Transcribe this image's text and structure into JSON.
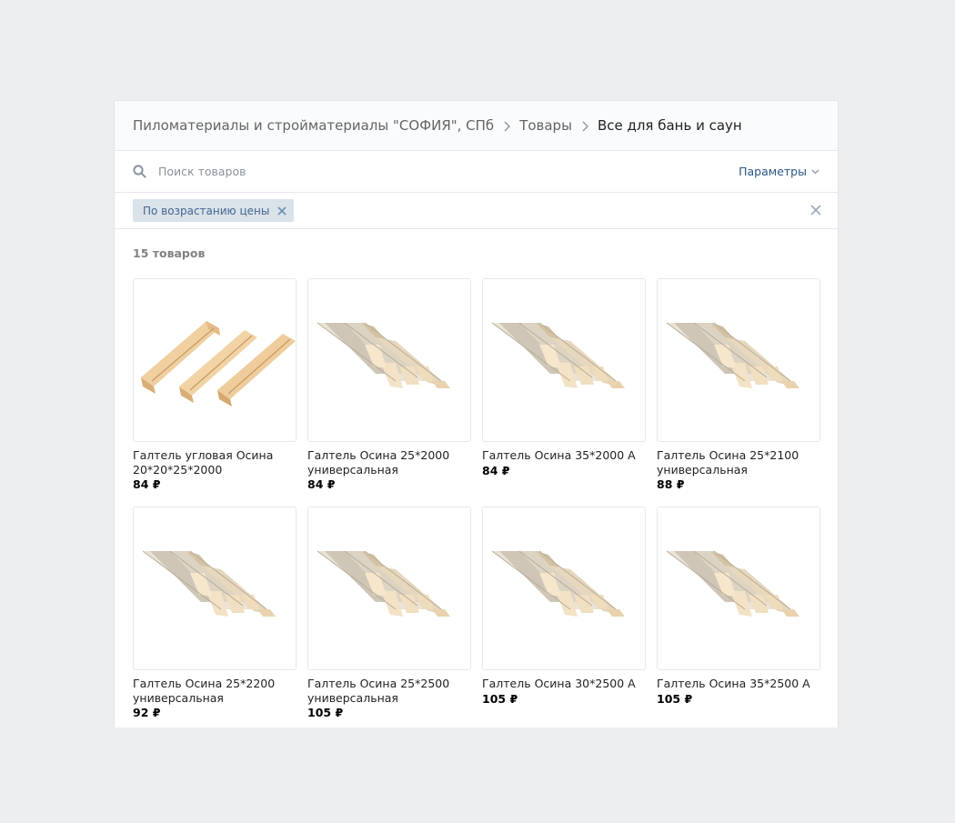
{
  "breadcrumbs": {
    "group": "Пиломатериалы и стройматериалы \"СОФИЯ\", СПб",
    "section": "Товары",
    "current": "Все для бань и саун"
  },
  "search": {
    "placeholder": "Поиск товаров",
    "value": "",
    "params_label": "Параметры"
  },
  "filters": {
    "active": [
      {
        "label": "По возрастанию цены"
      }
    ]
  },
  "results": {
    "count_label": "15 товаров"
  },
  "products": [
    {
      "title": "Галтель угловая Осина 20*20*25*2000",
      "price": "84 ₽",
      "image": "corner-moulding"
    },
    {
      "title": "Галтель Осина 25*2000 универсальная",
      "price": "84 ₽",
      "image": "moulding-bundle"
    },
    {
      "title": "Галтель Осина 35*2000 А",
      "price": "84 ₽",
      "image": "moulding-bundle"
    },
    {
      "title": "Галтель Осина 25*2100 универсальная",
      "price": "88 ₽",
      "image": "moulding-bundle"
    },
    {
      "title": "Галтель Осина 25*2200 универсальная",
      "price": "92 ₽",
      "image": "moulding-bundle"
    },
    {
      "title": "Галтель Осина 25*2500 универсальная",
      "price": "105 ₽",
      "image": "moulding-bundle"
    },
    {
      "title": "Галтель Осина 30*2500 А",
      "price": "105 ₽",
      "image": "moulding-bundle"
    },
    {
      "title": "Галтель Осина 35*2500 А",
      "price": "105 ₽",
      "image": "moulding-bundle"
    }
  ]
}
